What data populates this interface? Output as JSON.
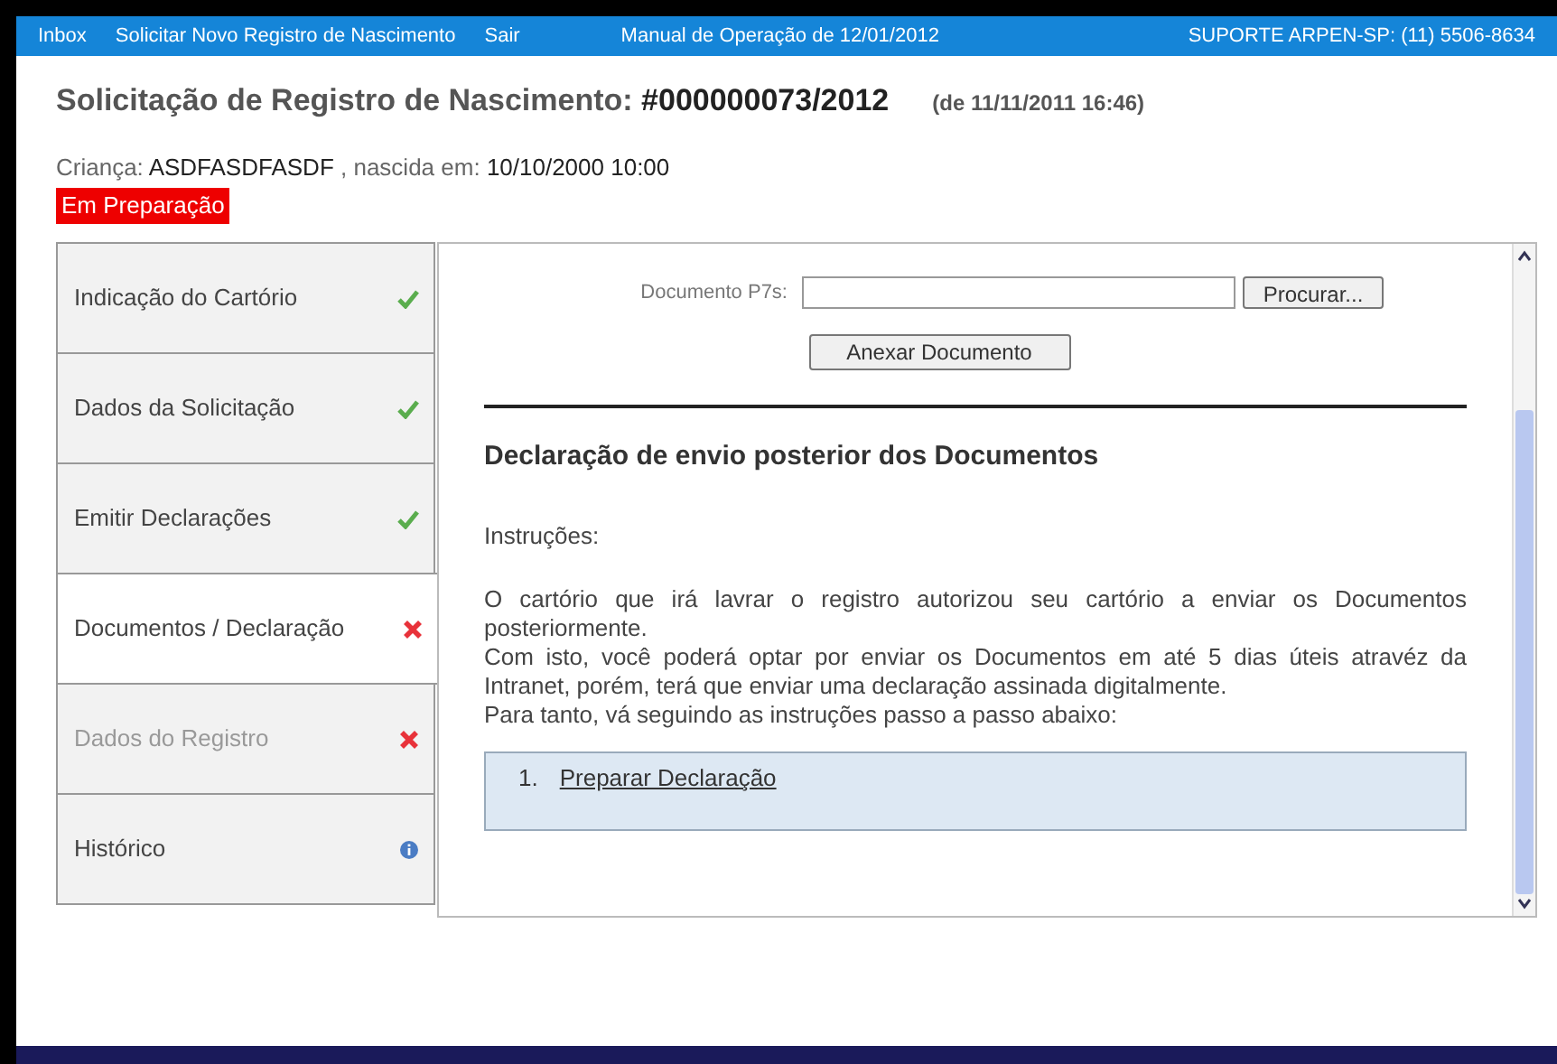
{
  "nav": {
    "links": [
      "Inbox",
      "Solicitar Novo Registro de Nascimento",
      "Sair",
      "Manual de Operação de 12/01/2012"
    ],
    "support": "SUPORTE ARPEN-SP: (11) 5506-8634"
  },
  "header": {
    "title": "Solicitação de Registro de Nascimento:",
    "number": "#000000073/2012",
    "date": "(de 11/11/2011 16:46)",
    "child_label": "Criança:",
    "child_name": "ASDFASDFASDF",
    "born_label": ", nascida em:",
    "born_date": "10/10/2000 10:00",
    "status": "Em Preparação"
  },
  "steps": [
    {
      "label": "Indicação do Cartório",
      "kind": "done",
      "selected": false,
      "disabled": false
    },
    {
      "label": "Dados da Solicitação",
      "kind": "done",
      "selected": false,
      "disabled": false
    },
    {
      "label": "Emitir Declarações",
      "kind": "done",
      "selected": false,
      "disabled": false
    },
    {
      "label": "Documentos / Declaração",
      "kind": "error",
      "selected": true,
      "disabled": false
    },
    {
      "label": "Dados do Registro",
      "kind": "error",
      "selected": false,
      "disabled": true
    },
    {
      "label": "Histórico",
      "kind": "info",
      "selected": false,
      "disabled": false
    }
  ],
  "upload": {
    "label": "Documento P7s:",
    "browse": "Procurar...",
    "attach": "Anexar Documento"
  },
  "section": {
    "title": "Declaração de envio posterior dos Documentos",
    "intro": "Instruções:",
    "paragraphs": [
      "O cartório que irá lavrar o registro autorizou seu cartório a enviar os Documentos posteriormente.",
      "Com isto, você poderá optar por enviar os Documentos em até 5 dias úteis atravéz da Intranet, porém, terá que enviar uma declaração assinada digitalmente.",
      "Para tanto, vá seguindo as instruções passo a passo abaixo:"
    ],
    "steps": [
      {
        "number": "1.",
        "label": "Preparar Declaração"
      }
    ]
  }
}
